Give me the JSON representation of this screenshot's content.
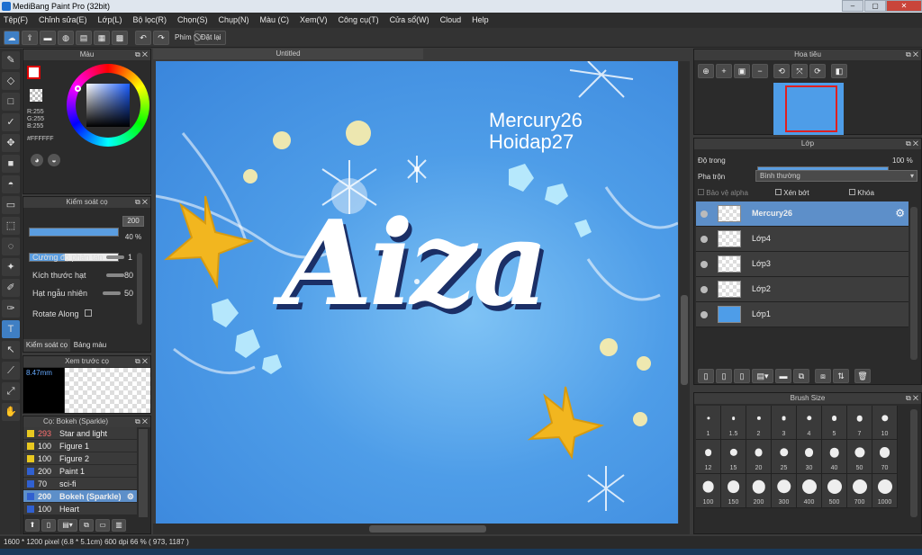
{
  "app": {
    "title": "MediBang Paint Pro (32bit)"
  },
  "menu": [
    "Tệp(F)",
    "Chỉnh sửa(E)",
    "Lớp(L)",
    "Bộ lọc(R)",
    "Chọn(S)",
    "Chụp(N)",
    "Màu (C)",
    "Xem(V)",
    "Công cụ(T)",
    "Cửa sổ(W)",
    "Cloud",
    "Help"
  ],
  "toolbar": {
    "hotkey_label": "Phím",
    "reset_label": "Đặt lại"
  },
  "color_panel": {
    "title": "Màu",
    "r": "R:255",
    "g": "G:255",
    "b": "B:255",
    "hex": "#FFFFFF"
  },
  "brush_control": {
    "title": "Kiểm soát cọ",
    "size_value": "200",
    "opacity_value": "40 %",
    "params": [
      {
        "label": "Cường độ phân tán",
        "value": "1"
      },
      {
        "label": "Kích thước hạt",
        "value": "80"
      },
      {
        "label": "Hạt ngẫu nhiên",
        "value": "50"
      }
    ],
    "rotate_label": "Rotate Along",
    "tab_control": "Kiểm soát cọ",
    "tab_palette": "Bảng màu"
  },
  "preview": {
    "title": "Xem trước cọ",
    "size": "8.47mm"
  },
  "brush_list": {
    "title": "Cọ: Bokeh (Sparkle)",
    "items": [
      {
        "num": "293",
        "name": "Star and light",
        "color": "#e8c820"
      },
      {
        "num": "100",
        "name": "Figure 1",
        "color": "#e8c820"
      },
      {
        "num": "100",
        "name": "Figure 2",
        "color": "#e8c820"
      },
      {
        "num": "200",
        "name": "Paint 1",
        "color": "#3060d0"
      },
      {
        "num": "70",
        "name": "sci-fi",
        "color": "#3060d0"
      },
      {
        "num": "200",
        "name": "Bokeh (Sparkle)",
        "color": "#3060d0"
      },
      {
        "num": "100",
        "name": "Heart",
        "color": "#3060d0"
      }
    ]
  },
  "canvas": {
    "tab": "Untitled",
    "text1": "Mercury26",
    "text2": "Hoidap27",
    "lettering": "Aiza"
  },
  "navigator": {
    "title": "Hoa tiêu"
  },
  "layers": {
    "title": "Lớp",
    "opacity_label": "Độ trong",
    "opacity_value": "100 %",
    "opacity": 1.0,
    "blend_label": "Pha trộn",
    "blend_value": "Bình thường",
    "protect_alpha": "Bảo vệ alpha",
    "clip": "Xén bớt",
    "lock": "Khóa",
    "items": [
      "Mercury26",
      "Lớp4",
      "Lớp3",
      "Lớp2",
      "Lớp1"
    ]
  },
  "brush_size": {
    "title": "Brush Size",
    "sizes": [
      "1",
      "1.5",
      "2",
      "3",
      "4",
      "5",
      "7",
      "10",
      "12",
      "15",
      "20",
      "25",
      "30",
      "40",
      "50",
      "70",
      "100",
      "150",
      "200",
      "300",
      "400",
      "500",
      "700",
      "1000"
    ]
  },
  "status": "1600 * 1200 pixel  (6.8 * 5.1cm)  600 dpi  66 %  ( 973, 1187 )",
  "colors": {
    "accent": "#3f7fc4",
    "canvas_bg": "#4e9de8"
  }
}
